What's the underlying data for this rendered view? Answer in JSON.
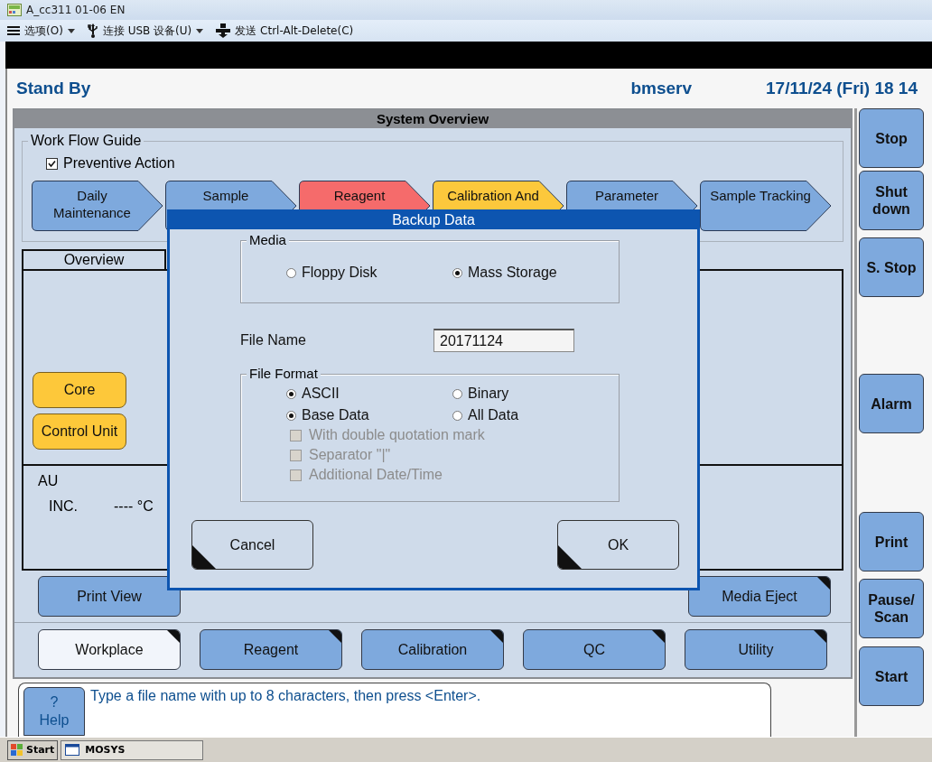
{
  "window": {
    "title": "A_cc311 01-06 EN"
  },
  "menu": [
    {
      "kind": "options",
      "label": "选项(O)",
      "dropdown": true
    },
    {
      "kind": "usb",
      "label": "连接 USB 设备(U)",
      "dropdown": true
    },
    {
      "kind": "send",
      "label": "发送 Ctrl-Alt-Delete(C)",
      "dropdown": false
    }
  ],
  "header": {
    "status": "Stand By",
    "user": "bmserv",
    "datetime": "17/11/24 (Fri) 18 14"
  },
  "system_overview": {
    "title": "System Overview",
    "workflow": {
      "title": "Work Flow Guide",
      "preventive_action": {
        "label": "Preventive Action",
        "checked": true
      },
      "steps": [
        {
          "label": "Daily Maintenance",
          "color": "#7ea9dd"
        },
        {
          "label": "Sample",
          "color": "#7ea9dd"
        },
        {
          "label": "Reagent",
          "color": "#f56b6b"
        },
        {
          "label": "Calibration And",
          "color": "#fcc83c"
        },
        {
          "label": "Parameter",
          "color": "#7ea9dd"
        },
        {
          "label": "Sample Tracking",
          "color": "#7ea9dd"
        }
      ]
    },
    "overview": {
      "title": "Overview",
      "units": [
        "Core",
        "Control Unit"
      ],
      "au": {
        "label": "AU",
        "inc_label": "INC.",
        "inc_value": "---- °C"
      }
    },
    "actions": [
      "Print View",
      "Media Eject"
    ]
  },
  "nav_tabs": [
    {
      "label": "Workplace",
      "selected": true
    },
    {
      "label": "Reagent",
      "selected": false
    },
    {
      "label": "Calibration",
      "selected": false
    },
    {
      "label": "QC",
      "selected": false
    },
    {
      "label": "Utility",
      "selected": false
    }
  ],
  "side_buttons": [
    "Stop",
    "Shut down",
    "S. Stop",
    "Alarm",
    "Print",
    "Pause/ Scan",
    "Start"
  ],
  "help": {
    "symbol": "?",
    "label": "Help",
    "message": "Type a file name with up to 8 characters, then press <Enter>."
  },
  "dialog": {
    "title": "Backup Data",
    "media": {
      "title": "Media",
      "options": [
        {
          "label": "Floppy Disk",
          "selected": false
        },
        {
          "label": "Mass Storage",
          "selected": true
        }
      ]
    },
    "file_name": {
      "label": "File Name",
      "value": "20171124"
    },
    "file_format": {
      "title": "File Format",
      "encoding": [
        {
          "label": "ASCII",
          "selected": true
        },
        {
          "label": "Binary",
          "selected": false
        }
      ],
      "scope": [
        {
          "label": "Base Data",
          "selected": true
        },
        {
          "label": "All Data",
          "selected": false
        }
      ],
      "options": [
        {
          "label": "With double quotation mark",
          "checked": false,
          "disabled": true
        },
        {
          "label": "Separator \"|\"",
          "checked": false,
          "disabled": true
        },
        {
          "label": "Additional Date/Time",
          "checked": false,
          "disabled": true
        }
      ]
    },
    "buttons": [
      "Cancel",
      "OK"
    ]
  },
  "taskbar": {
    "start": "Start",
    "windows": [
      "MOSYS"
    ]
  }
}
